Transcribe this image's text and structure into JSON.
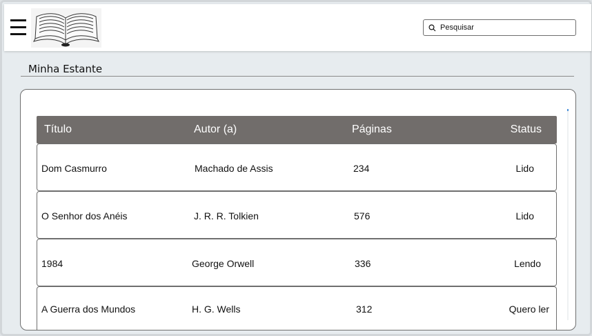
{
  "header": {
    "menu_icon": "hamburger-menu-icon",
    "logo_icon": "open-book-icon",
    "search": {
      "placeholder": "Pesquisar",
      "icon": "search-icon"
    }
  },
  "page": {
    "title": "Minha Estante"
  },
  "table": {
    "columns": [
      "Título",
      "Autor (a)",
      "Páginas",
      "Status"
    ],
    "rows": [
      {
        "title": "Dom Casmurro",
        "author": "Machado de Assis",
        "pages": "234",
        "status": "Lido"
      },
      {
        "title": "O Senhor dos Anéis",
        "author": "J. R. R. Tolkien",
        "pages": "576",
        "status": "Lido"
      },
      {
        "title": "1984",
        "author": "George Orwell",
        "pages": "336",
        "status": "Lendo"
      },
      {
        "title": "A Guerra dos Mundos",
        "author": "H. G. Wells",
        "pages": "312",
        "status": "Quero ler"
      }
    ]
  },
  "colors": {
    "header_bg": "#716d6b",
    "accent_scroll": "#4a90d9"
  }
}
